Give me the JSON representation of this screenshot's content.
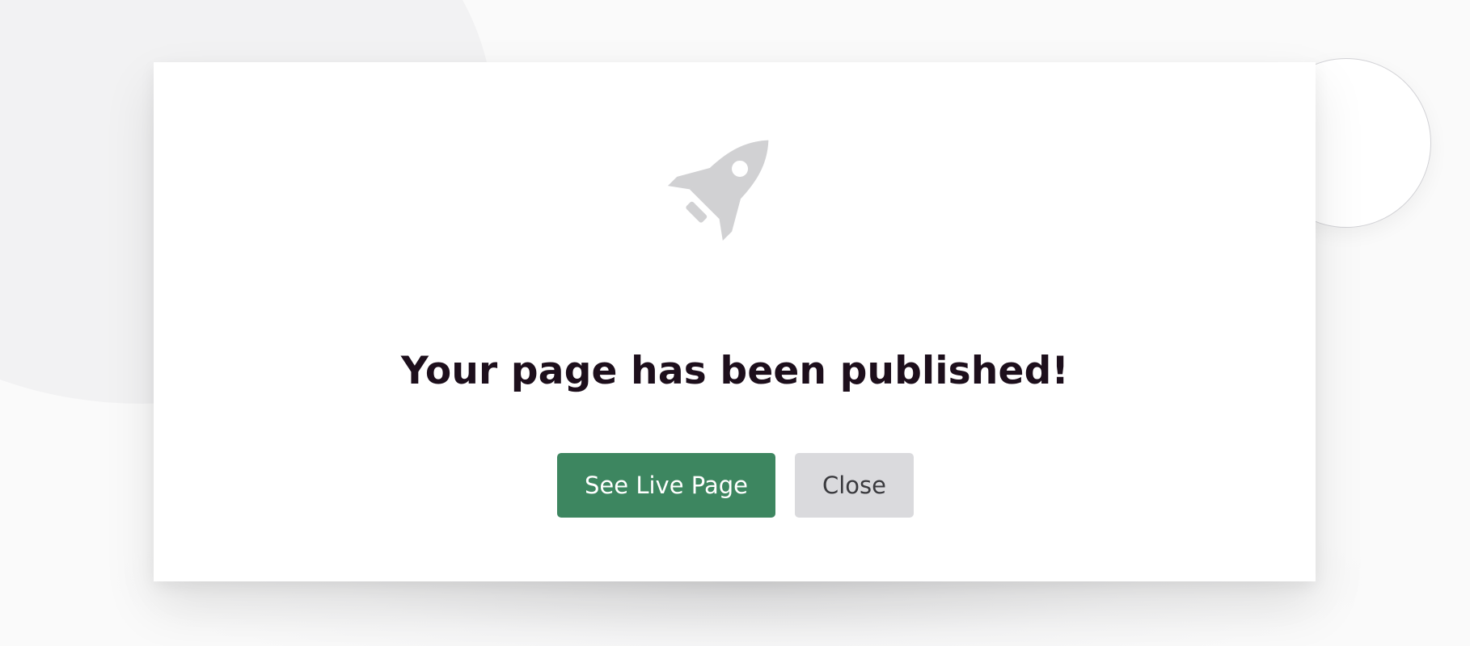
{
  "dialog": {
    "icon": "rocket-icon",
    "title": "Your page has been published!",
    "primary_button_label": "See Live Page",
    "secondary_button_label": "Close"
  },
  "colors": {
    "primary_button_bg": "#3d8660",
    "secondary_button_bg": "#dadadd",
    "title_text": "#1d0f1c",
    "icon": "#d1d1d3"
  }
}
